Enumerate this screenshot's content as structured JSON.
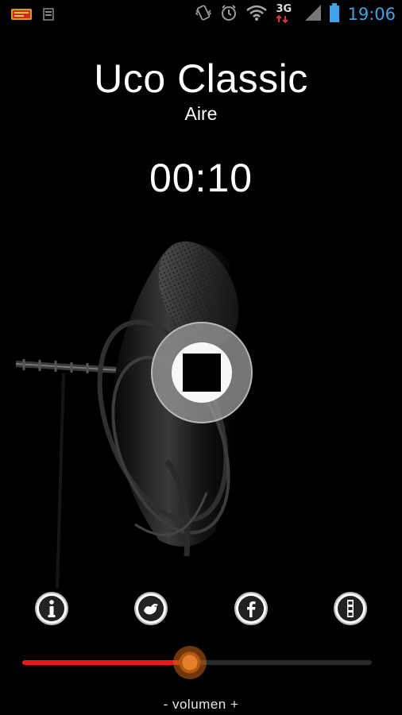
{
  "status_bar": {
    "time": "19:06",
    "network_label": "3G",
    "left_icons": [
      "radio-app-icon",
      "notification-icon"
    ],
    "right_icons": [
      "vibrate-icon",
      "alarm-icon",
      "wifi-icon",
      "network-3g-icon",
      "signal-icon",
      "battery-icon"
    ]
  },
  "player": {
    "station_name": "Uco Classic",
    "status": "Aire",
    "elapsed": "00:10",
    "stop_icon": "stop-icon"
  },
  "actions": [
    {
      "name": "info-button",
      "icon": "info-icon"
    },
    {
      "name": "twitter-button",
      "icon": "twitter-icon"
    },
    {
      "name": "facebook-button",
      "icon": "facebook-icon"
    },
    {
      "name": "menu-button",
      "icon": "menu-icon"
    }
  ],
  "volume": {
    "label": "- volumen +",
    "level_fraction": 0.48,
    "fill_color": "#ee1616",
    "thumb_color": "#e57f2a"
  },
  "colors": {
    "background": "#000000",
    "status_time": "#3ea3e6"
  }
}
